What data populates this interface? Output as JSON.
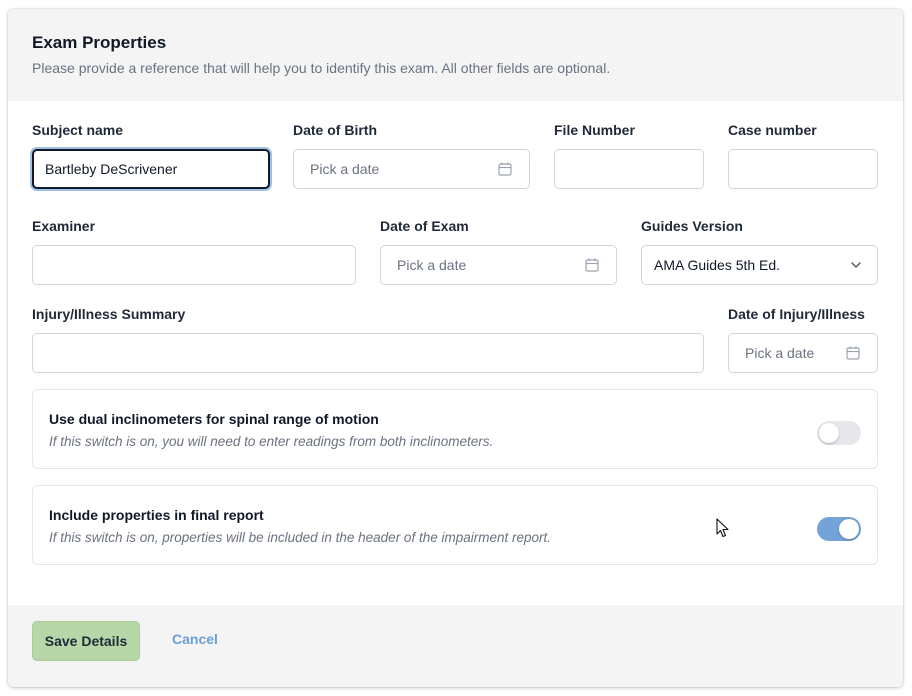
{
  "header": {
    "title": "Exam Properties",
    "subtitle": "Please provide a reference that will help you to identify this exam. All other fields are optional."
  },
  "fields": {
    "subject_name": {
      "label": "Subject name",
      "value": "Bartleby DeScrivener"
    },
    "date_of_birth": {
      "label": "Date of Birth",
      "placeholder": "Pick a date"
    },
    "file_number": {
      "label": "File Number",
      "value": ""
    },
    "case_number": {
      "label": "Case number",
      "value": ""
    },
    "examiner": {
      "label": "Examiner",
      "value": ""
    },
    "date_of_exam": {
      "label": "Date of Exam",
      "placeholder": "Pick a date"
    },
    "guides_version": {
      "label": "Guides Version",
      "selected": "AMA Guides 5th Ed."
    },
    "injury_summary": {
      "label": "Injury/Illness Summary",
      "value": ""
    },
    "date_of_injury": {
      "label": "Date of Injury/Illness",
      "placeholder": "Pick a date"
    }
  },
  "switches": [
    {
      "title": "Use dual inclinometers for spinal range of motion",
      "description": "If this switch is on, you will need to enter readings from both inclinometers.",
      "on": false
    },
    {
      "title": "Include properties in final report",
      "description": "If this switch is on, properties will be included in the header of the impairment report.",
      "on": true
    }
  ],
  "footer": {
    "save_label": "Save Details",
    "cancel_label": "Cancel"
  },
  "icons": {
    "date_picker": "calendar-icon",
    "dropdown": "chevron-down-icon",
    "pointer": "mouse-cursor-icon"
  },
  "colors": {
    "save_button": "#b7d7a8",
    "toggle_on": "#74a3d8",
    "cancel_link": "#6b9fd4",
    "focus_ring": "#9ec2e6"
  }
}
